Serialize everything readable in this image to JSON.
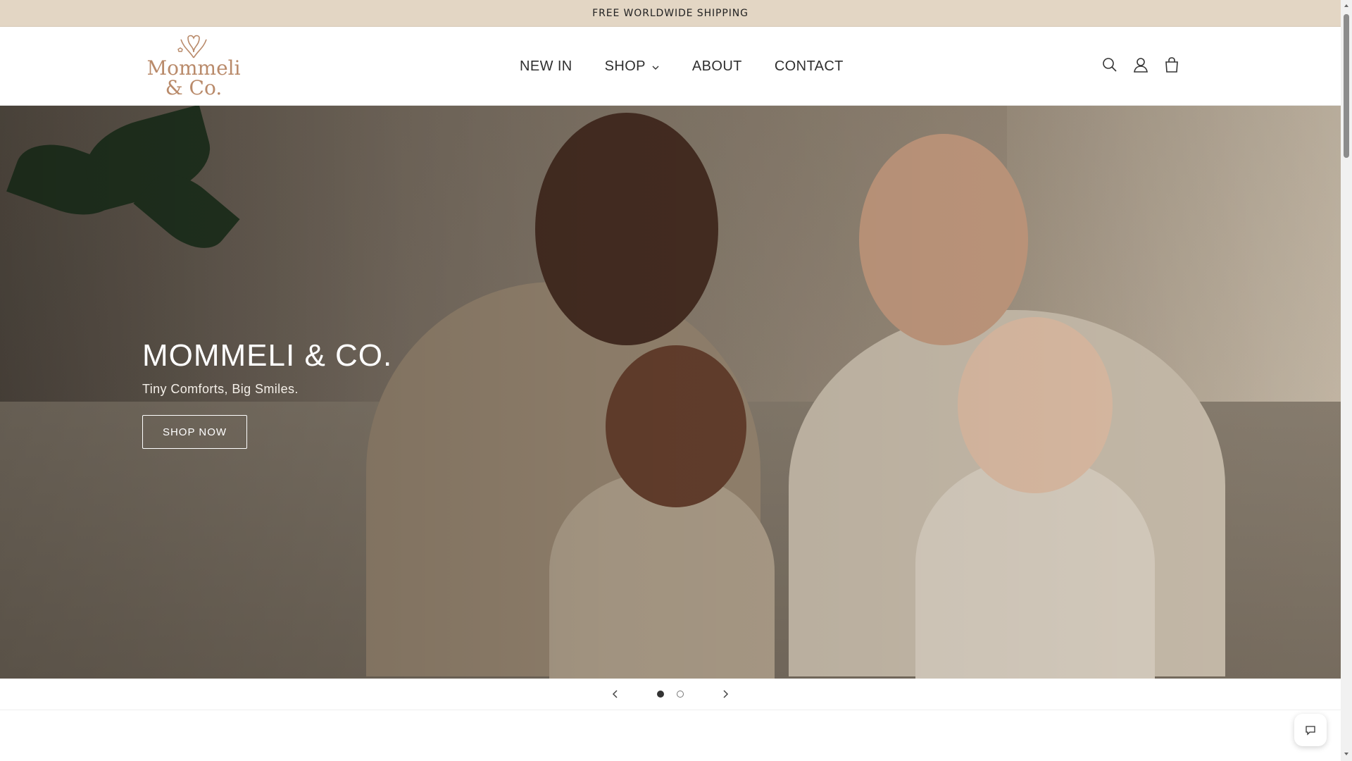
{
  "announcement": {
    "text": "FREE WORLDWIDE SHIPPING"
  },
  "logo": {
    "line1": "Mommeli",
    "line2": "& Co."
  },
  "nav": {
    "items": [
      {
        "label": "NEW IN",
        "has_dropdown": false
      },
      {
        "label": "SHOP",
        "has_dropdown": true
      },
      {
        "label": "ABOUT",
        "has_dropdown": false
      },
      {
        "label": "CONTACT",
        "has_dropdown": false
      }
    ]
  },
  "header_icons": [
    "search-icon",
    "account-icon",
    "cart-icon"
  ],
  "hero": {
    "title": "MOMMELI & CO.",
    "subtitle": "Tiny Comforts, Big Smiles.",
    "button_label": "SHOP NOW"
  },
  "slider": {
    "total_slides": 2,
    "active_slide": 1
  },
  "colors": {
    "announcement_bg": "#e3d6c4",
    "brand": "#b98a6a",
    "text": "#2b2b2b"
  }
}
